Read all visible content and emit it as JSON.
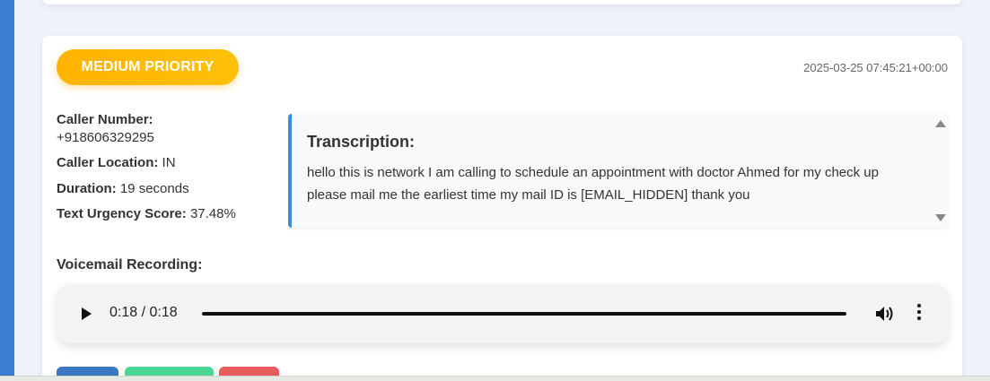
{
  "card": {
    "priority_label": "MEDIUM PRIORITY",
    "timestamp": "2025-03-25 07:45:21+00:00",
    "caller_number_label": "Caller Number:",
    "caller_number": "+918606329295",
    "caller_location_label": "Caller Location:",
    "caller_location": "IN",
    "duration_label": "Duration:",
    "duration": "19 seconds",
    "urgency_label": "Text Urgency Score:",
    "urgency": "37.48%",
    "transcription_title": "Transcription:",
    "transcription_text": "hello this is network I am calling to schedule an appointment with doctor Ahmed for my check up please mail me the earliest time my mail ID is [EMAIL_HIDDEN] thank you",
    "voicemail_title": "Voicemail Recording:",
    "audio_time": "0:18 / 0:18",
    "audio_progress": 1.0
  },
  "icons": {
    "play": "play-icon",
    "volume": "volume-icon",
    "more": "more-options-icon",
    "scroll_up": "scroll-up-icon",
    "scroll_down": "scroll-down-icon"
  },
  "colors": {
    "priority_medium": "#ffb300",
    "accent_blue": "#3a8fd6",
    "action_blue": "#3a78c2",
    "action_green": "#4ad693",
    "action_red": "#e85c5c"
  }
}
